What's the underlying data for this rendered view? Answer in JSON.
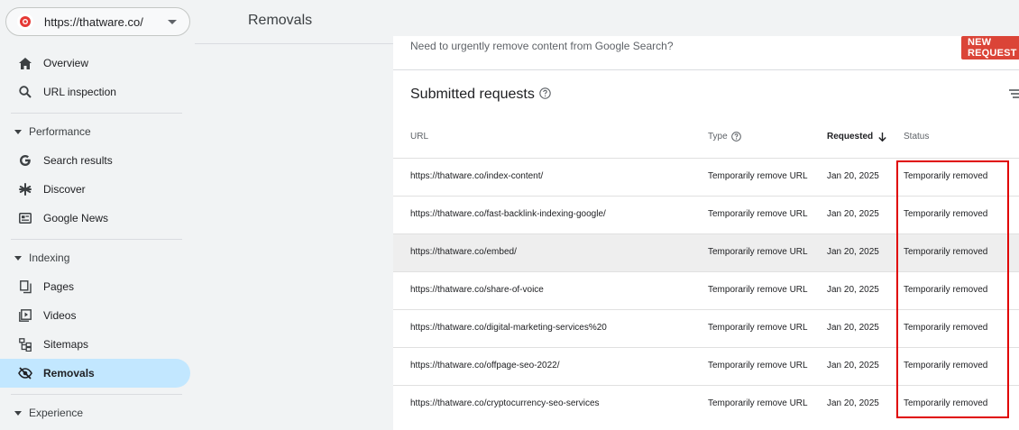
{
  "property": {
    "label": "https://thatware.co/"
  },
  "sidebar": {
    "top_items": [
      {
        "label": "Overview",
        "icon": "home-icon"
      },
      {
        "label": "URL inspection",
        "icon": "search-icon"
      }
    ],
    "performance": {
      "header": "Performance",
      "items": [
        {
          "label": "Search results",
          "icon": "google-g-icon"
        },
        {
          "label": "Discover",
          "icon": "asterisk-icon"
        },
        {
          "label": "Google News",
          "icon": "news-icon"
        }
      ]
    },
    "indexing": {
      "header": "Indexing",
      "items": [
        {
          "label": "Pages",
          "icon": "pages-icon"
        },
        {
          "label": "Videos",
          "icon": "video-icon"
        },
        {
          "label": "Sitemaps",
          "icon": "sitemap-icon"
        },
        {
          "label": "Removals",
          "icon": "eye-off-icon",
          "active": true
        }
      ]
    },
    "experience": {
      "header": "Experience"
    }
  },
  "header": {
    "title": "Removals"
  },
  "card": {
    "urgent_text": "Need to urgently remove content from Google Search?",
    "new_request_label": "NEW REQUEST",
    "section_title": "Submitted requests",
    "columns": {
      "url": "URL",
      "type": "Type",
      "requested": "Requested",
      "status": "Status"
    },
    "rows": [
      {
        "url": "https://thatware.co/index-content/",
        "type": "Temporarily remove URL",
        "requested": "Jan 20, 2025",
        "status": "Temporarily removed"
      },
      {
        "url": "https://thatware.co/fast-backlink-indexing-google/",
        "type": "Temporarily remove URL",
        "requested": "Jan 20, 2025",
        "status": "Temporarily removed"
      },
      {
        "url": "https://thatware.co/embed/",
        "type": "Temporarily remove URL",
        "requested": "Jan 20, 2025",
        "status": "Temporarily removed"
      },
      {
        "url": "https://thatware.co/share-of-voice",
        "type": "Temporarily remove URL",
        "requested": "Jan 20, 2025",
        "status": "Temporarily removed"
      },
      {
        "url": "https://thatware.co/digital-marketing-services%20",
        "type": "Temporarily remove URL",
        "requested": "Jan 20, 2025",
        "status": "Temporarily removed"
      },
      {
        "url": "https://thatware.co/offpage-seo-2022/",
        "type": "Temporarily remove URL",
        "requested": "Jan 20, 2025",
        "status": "Temporarily removed"
      },
      {
        "url": "https://thatware.co/cryptocurrency-seo-services",
        "type": "Temporarily remove URL",
        "requested": "Jan 20, 2025",
        "status": "Temporarily removed"
      }
    ]
  },
  "colors": {
    "accent_active": "#c2e7ff",
    "new_request": "#db4437",
    "highlight_box": "#e00000"
  }
}
